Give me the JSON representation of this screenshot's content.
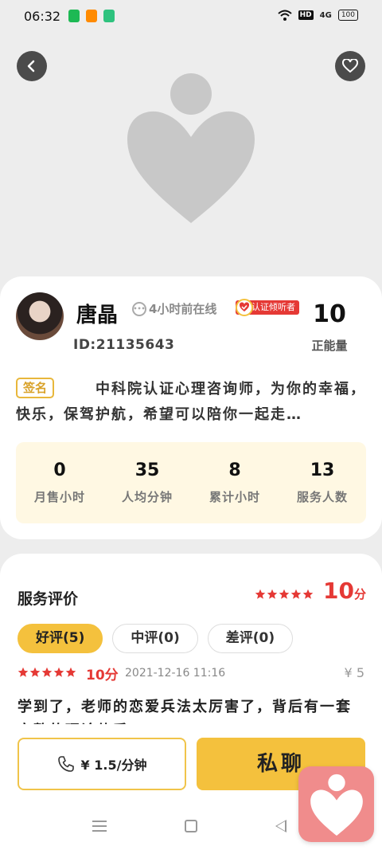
{
  "status_bar": {
    "time": "06:32",
    "network_hd": "HD",
    "network_signal": "4G",
    "battery": "100"
  },
  "hero": {
    "back_icon": "chevron-left-icon",
    "favorite_icon": "heart-icon",
    "placeholder_logo": "heart-person-logo"
  },
  "profile": {
    "name": "唐晶",
    "online_status": "4小时前在线",
    "certification": "认证倾听者",
    "user_id": "ID:21135643",
    "energy_value": "10",
    "energy_label": "正能量",
    "signature_tag": "签名",
    "signature": "中科院认证心理咨询师，为你的幸福，快乐，保驾护航，希望可以陪你一起走…"
  },
  "stats": [
    {
      "value": "0",
      "label": "月售小时"
    },
    {
      "value": "35",
      "label": "人均分钟"
    },
    {
      "value": "8",
      "label": "累计小时"
    },
    {
      "value": "13",
      "label": "服务人数"
    }
  ],
  "reviews": {
    "title": "服务评价",
    "overall_stars": 5,
    "overall_score": "10",
    "score_unit": "分",
    "tabs": [
      {
        "label": "好评(5)",
        "active": true
      },
      {
        "label": "中评(0)",
        "active": false
      },
      {
        "label": "差评(0)",
        "active": false
      }
    ],
    "items": [
      {
        "stars": 5,
        "score": "10分",
        "date": "2021-12-16 11:16",
        "price": "¥ 5",
        "text": "学到了，老师的恋爱兵法太厉害了，背后有一套完整的理论体系"
      }
    ]
  },
  "actions": {
    "call_icon": "phone-icon",
    "call_price": "¥ 1.5/分钟",
    "chat_label": "私聊"
  },
  "colors": {
    "accent_yellow": "#f4c13d",
    "score_red": "#e53935",
    "stats_bg": "#fff8e3",
    "float_app_bg": "#f08c8c"
  }
}
